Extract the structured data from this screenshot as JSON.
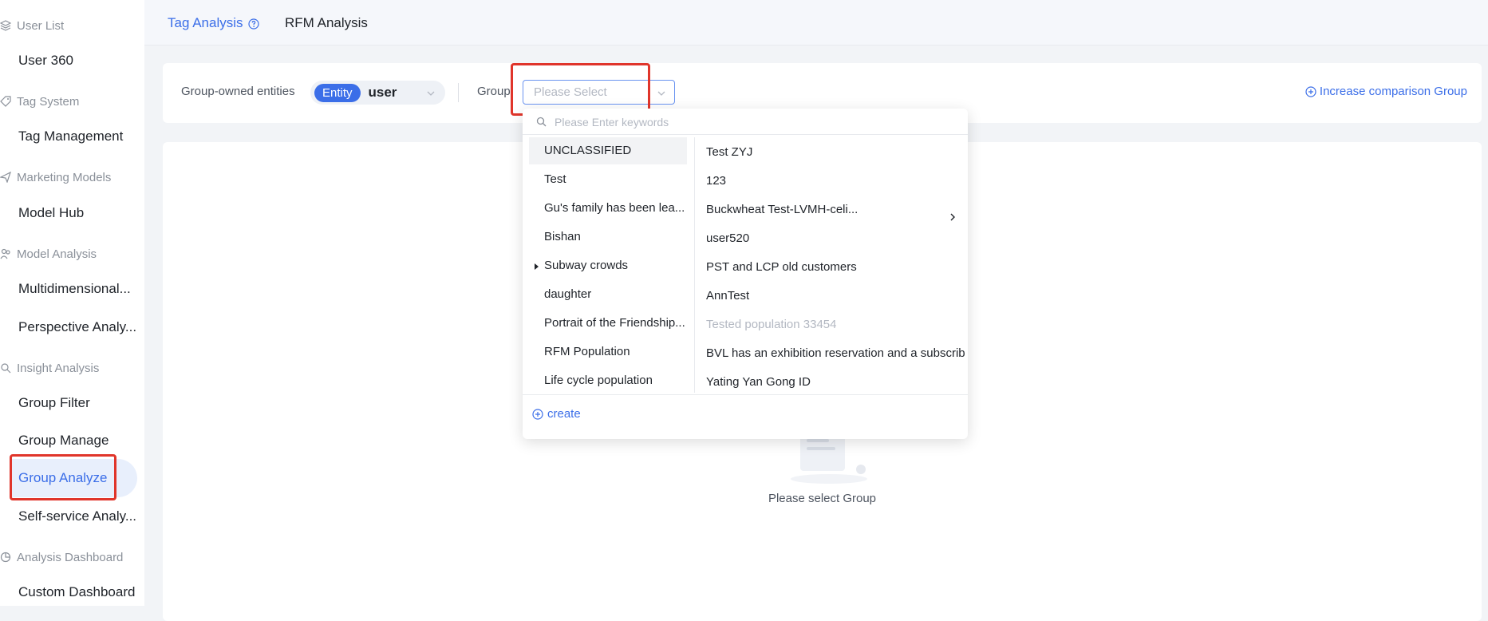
{
  "sidebar": {
    "sections": [
      {
        "label": "User List",
        "icon": "layers-icon",
        "items": [
          "User 360"
        ]
      },
      {
        "label": "Tag System",
        "icon": "tag-icon",
        "items": [
          "Tag Management"
        ]
      },
      {
        "label": "Marketing Models",
        "icon": "send-icon",
        "items": [
          "Model Hub"
        ]
      },
      {
        "label": "Model Analysis",
        "icon": "users-icon",
        "items": [
          "Multidimensional...",
          "Perspective Analy..."
        ]
      },
      {
        "label": "Insight Analysis",
        "icon": "insight-icon",
        "items": [
          "Group Filter",
          "Group Manage",
          "Group Analyze",
          "Self-service Analy..."
        ]
      },
      {
        "label": "Analysis Dashboard",
        "icon": "pie-icon",
        "items": [
          "Custom Dashboard"
        ]
      }
    ],
    "active_item": "Group Analyze"
  },
  "tabs": [
    {
      "label": "Tag Analysis",
      "active": true
    },
    {
      "label": "RFM Analysis",
      "active": false
    }
  ],
  "filter": {
    "entity_label": "Group-owned entities",
    "entity_tag": "Entity",
    "entity_value": "user",
    "group_label": "Group",
    "group_placeholder": "Please Select",
    "add_compare": "Increase comparison Group"
  },
  "main": {
    "empty_text": "Please select Group"
  },
  "dropdown": {
    "search_placeholder": "Please Enter keywords",
    "categories": [
      {
        "label": "UNCLASSIFIED",
        "highlighted": true,
        "expandable": false
      },
      {
        "label": "Test",
        "highlighted": false,
        "expandable": false
      },
      {
        "label": "Gu's family has been lea...",
        "highlighted": false,
        "expandable": false
      },
      {
        "label": "Bishan",
        "highlighted": false,
        "expandable": false
      },
      {
        "label": "Subway crowds",
        "highlighted": false,
        "expandable": true
      },
      {
        "label": "daughter",
        "highlighted": false,
        "expandable": false
      },
      {
        "label": "Portrait of the Friendship...",
        "highlighted": false,
        "expandable": false
      },
      {
        "label": "RFM Population",
        "highlighted": false,
        "expandable": false
      },
      {
        "label": "Life cycle population",
        "highlighted": false,
        "expandable": false
      }
    ],
    "groups": [
      {
        "label": "Test ZYJ",
        "disabled": false,
        "has_children": false
      },
      {
        "label": "123",
        "disabled": false,
        "has_children": false
      },
      {
        "label": "Buckwheat Test-LVMH-celi...",
        "disabled": false,
        "has_children": true
      },
      {
        "label": "user520",
        "disabled": false,
        "has_children": false
      },
      {
        "label": "PST and LCP old customers",
        "disabled": false,
        "has_children": false
      },
      {
        "label": "AnnTest",
        "disabled": false,
        "has_children": false
      },
      {
        "label": "Tested population 33454",
        "disabled": true,
        "has_children": false
      },
      {
        "label": "BVL has an exhibition reservation and a subscriber",
        "disabled": false,
        "has_children": false
      },
      {
        "label": "Yating Yan Gong ID",
        "disabled": false,
        "has_children": false
      }
    ],
    "create_label": "create"
  },
  "colors": {
    "accent": "#3b6ee8",
    "highlight_box": "#e0352b"
  }
}
